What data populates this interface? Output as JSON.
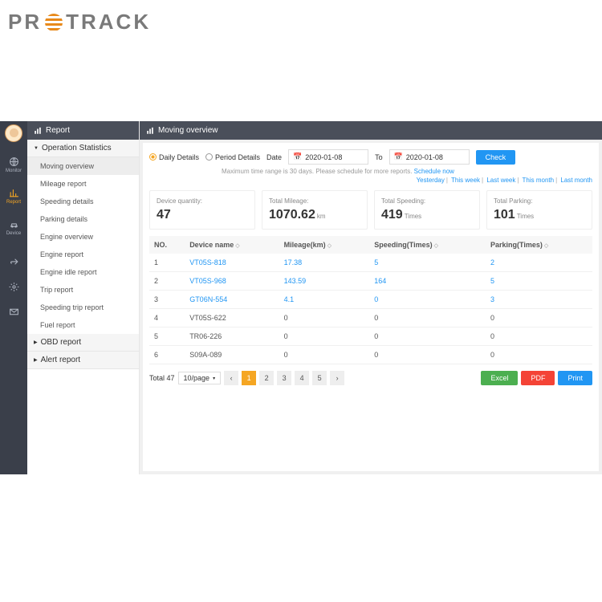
{
  "brand": "PROTRACK",
  "rail": {
    "monitor": "Monitor",
    "report": "Report",
    "device": "Device"
  },
  "side": {
    "title": "Report",
    "groups": [
      "Operation Statistics",
      "OBD report",
      "Alert report"
    ],
    "items": [
      "Moving overview",
      "Mileage report",
      "Speeding details",
      "Parking details",
      "Engine overview",
      "Engine report",
      "Engine idle report",
      "Trip report",
      "Speeding trip report",
      "Fuel report"
    ]
  },
  "panel": {
    "title": "Moving overview"
  },
  "filter": {
    "daily": "Daily Details",
    "period": "Period Details",
    "date": "Date",
    "to": "To",
    "from_val": "2020-01-08",
    "to_val": "2020-01-08",
    "check": "Check",
    "hint": "Maximum time range is 30 days. Please schedule for more reports.",
    "schedule": "Schedule now",
    "quick": [
      "Yesterday",
      "This week",
      "Last week",
      "This month",
      "Last month"
    ]
  },
  "cards": [
    {
      "label": "Device quantity:",
      "val": "47",
      "unit": ""
    },
    {
      "label": "Total Mileage:",
      "val": "1070.62",
      "unit": "km"
    },
    {
      "label": "Total Speeding:",
      "val": "419",
      "unit": "Times"
    },
    {
      "label": "Total Parking:",
      "val": "101",
      "unit": "Times"
    }
  ],
  "cols": {
    "no": "NO.",
    "name": "Device name",
    "mileage": "Mileage(km)",
    "speeding": "Speeding(Times)",
    "parking": "Parking(Times)"
  },
  "rows": [
    {
      "no": "1",
      "name": "VT05S-818",
      "m": "17.38",
      "s": "5",
      "p": "2",
      "l": true
    },
    {
      "no": "2",
      "name": "VT05S-968",
      "m": "143.59",
      "s": "164",
      "p": "5",
      "l": true
    },
    {
      "no": "3",
      "name": "GT06N-554",
      "m": "4.1",
      "s": "0",
      "p": "3",
      "l": true
    },
    {
      "no": "4",
      "name": "VT05S-622",
      "m": "0",
      "s": "0",
      "p": "0",
      "l": false
    },
    {
      "no": "5",
      "name": "TR06-226",
      "m": "0",
      "s": "0",
      "p": "0",
      "l": false
    },
    {
      "no": "6",
      "name": "S09A-089",
      "m": "0",
      "s": "0",
      "p": "0",
      "l": false
    }
  ],
  "pager": {
    "total": "Total 47",
    "per": "10/page",
    "pages": [
      "1",
      "2",
      "3",
      "4",
      "5"
    ]
  },
  "export": {
    "excel": "Excel",
    "pdf": "PDF",
    "print": "Print"
  }
}
